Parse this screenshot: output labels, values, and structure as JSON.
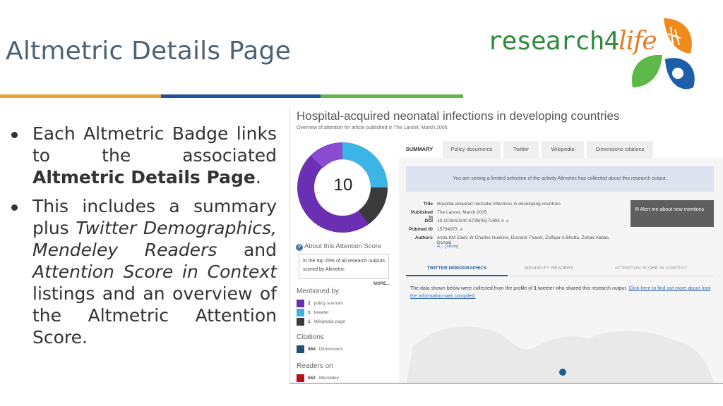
{
  "slide": {
    "title": "Altmetric Details Page",
    "logo": {
      "text_research": "research",
      "text_4": "4",
      "text_life": "life"
    },
    "colors": {
      "orange": "#e8a13a",
      "blue": "#1c4f9c",
      "green": "#63b545"
    }
  },
  "bullets": {
    "b1_prefix": "Each Altmetric Badge links to the associated ",
    "b1_bold": "Altmetric Details Page",
    "b1_suffix": ".",
    "b2_a": "This includes a summary plus ",
    "b2_italic": "Twitter Demographics, Mendeley Readers",
    "b2_b": " and ",
    "b2_italic2": "Attention Score in Context",
    "b2_c": " listings and an overview of the Altmetric Attention Score."
  },
  "screenshot": {
    "article_title": "Hospital-acquired neonatal infections in developing countries",
    "article_subtitle": "Overview of attention for article published in The Lancet, March 2005",
    "score": "10",
    "about_label": "About this Attention Score",
    "context_text": "In the top 25% of all research outputs scored by Altmetric",
    "more_label": "MORE...",
    "mentioned_by": {
      "heading": "Mentioned by",
      "items": [
        {
          "count": "2",
          "label": "policy sources",
          "color": "#6b2fb3"
        },
        {
          "count": "1",
          "label": "tweeter",
          "color": "#3db4e6"
        },
        {
          "count": "1",
          "label": "Wikipedia page",
          "color": "#3a3a3a"
        }
      ]
    },
    "citations": {
      "heading": "Citations",
      "count": "464",
      "label": "Dimensions",
      "color": "#1f4e79"
    },
    "readers": {
      "heading": "Readers on",
      "count": "553",
      "label": "Mendeley",
      "color": "#b3121c"
    },
    "tabs": [
      "SUMMARY",
      "Policy documents",
      "Twitter",
      "Wikipedia",
      "Dimensions citations"
    ],
    "notice": "You are seeing a limited selection of the activity Altmetric has collected about this research output.",
    "meta": [
      {
        "key": "Title",
        "value": "Hospital-acquired neonatal infections in developing countries"
      },
      {
        "key": "Published in",
        "value": "The Lancet, March 2005"
      },
      {
        "key": "DOI",
        "value": "10.1016/s0140-6736(05)71881-x"
      },
      {
        "key": "Pubmed ID",
        "value": "15794973"
      },
      {
        "key": "Authors",
        "value": "Anita KM Zaidi, W Charles Huskins, Durrane Thaver, Zulfiqar A Bhutta, Zohair Abbas, Donald"
      },
      {
        "key": "",
        "value": "A... [show]"
      }
    ],
    "alert_button": "Alert me about new mentions",
    "subtabs": [
      "TWITTER DEMOGRAPHICS",
      "MENDELEY READERS",
      "ATTENTION SCORE IN CONTEXT"
    ],
    "twitter_note_a": "The data shown below were collected from the profile of ",
    "twitter_note_bold": "1",
    "twitter_note_b": " tweeter who shared this research output. ",
    "twitter_note_link": "Click here to find out more about how the information was compiled."
  }
}
